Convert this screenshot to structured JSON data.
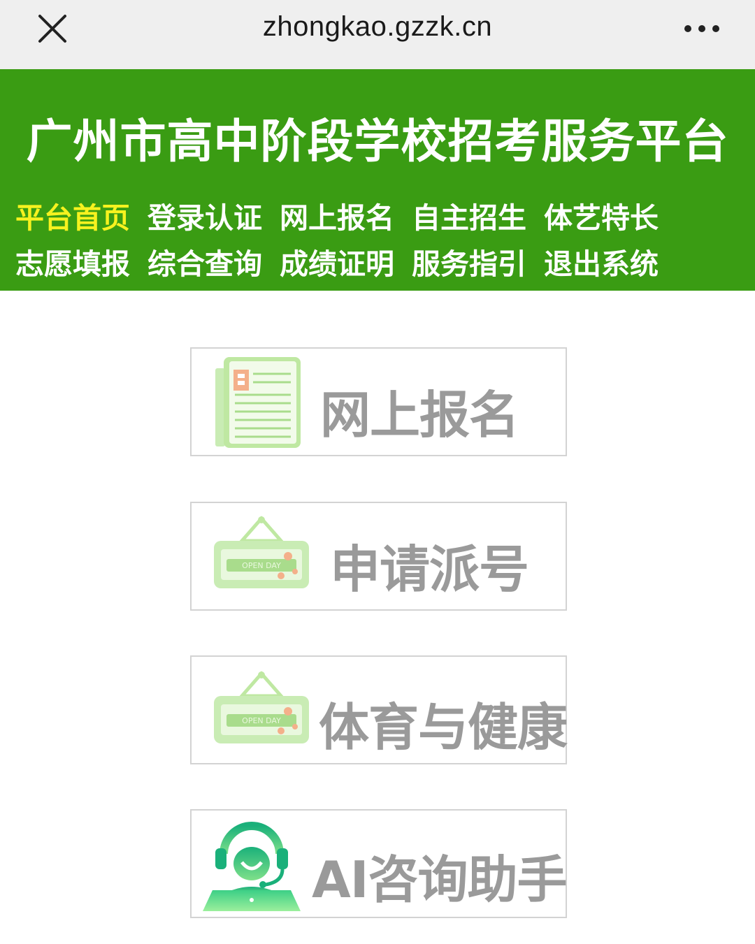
{
  "browser": {
    "url": "zhongkao.gzzk.cn",
    "close_icon": "close-icon",
    "more_icon": "more-icon"
  },
  "header": {
    "title": "广州市高中阶段学校招考服务平台",
    "nav_rows": [
      [
        "平台首页",
        "登录认证",
        "网上报名",
        "自主招生",
        "体艺特长"
      ],
      [
        "志愿填报",
        "综合查询",
        "成绩证明",
        "服务指引",
        "退出系统"
      ]
    ],
    "active_item": "平台首页",
    "active_color": "#f7f21f",
    "bg_color": "#3a9c13"
  },
  "cards": [
    {
      "label": "网上报名",
      "icon": "form-document-icon"
    },
    {
      "label": "申请派号",
      "icon": "open-day-sign-icon"
    },
    {
      "label": "体育与健康",
      "icon": "open-day-sign-icon"
    },
    {
      "label": "AI咨询助手",
      "icon": "ai-assistant-headset-icon"
    }
  ]
}
